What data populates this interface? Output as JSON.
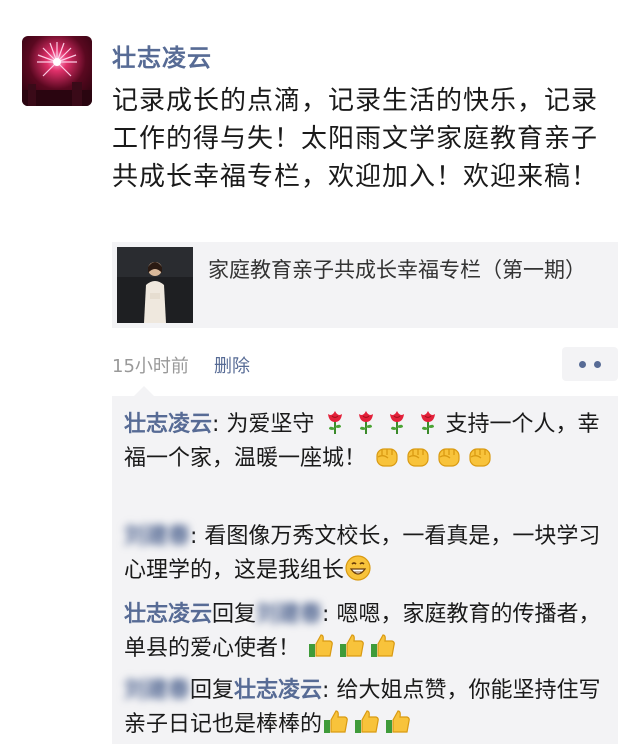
{
  "post": {
    "author": "壮志凌云",
    "text": "记录成长的点滴，记录生活的快乐，记录工作的得与失！太阳雨文学家庭教育亲子共成长幸福专栏，欢迎加入！欢迎来稿！",
    "share_title": "家庭教育亲子共成长幸福专栏（第一期）",
    "time": "15小时前",
    "delete_label": "删除"
  },
  "icons": {
    "rose": "rose-icon",
    "fist": "fist-icon",
    "grin": "grin-icon",
    "thumbs_up": "thumbs-up-icon",
    "more": "more-dots-icon"
  },
  "colors": {
    "link": "#576b95",
    "comment_bg": "#f3f3f5"
  },
  "comments": [
    {
      "author": "壮志凌云",
      "text_1": "为爱坚守",
      "text_2": "支持一个人，幸福一个家，温暖一座城！"
    },
    {
      "author": "刘建春",
      "text": "看图像万秀文校长，一看真是，一块学习心理学的，这是我组长"
    },
    {
      "author": "壮志凌云",
      "reply_label": "回复",
      "reply_to": "刘建春",
      "text": "嗯嗯，家庭教育的传播者，单县的爱心使者！"
    },
    {
      "author": "刘建春",
      "reply_label": "回复",
      "reply_to": "壮志凌云",
      "text": "给大姐点赞，你能坚持住写亲子日记也是棒棒的"
    }
  ]
}
